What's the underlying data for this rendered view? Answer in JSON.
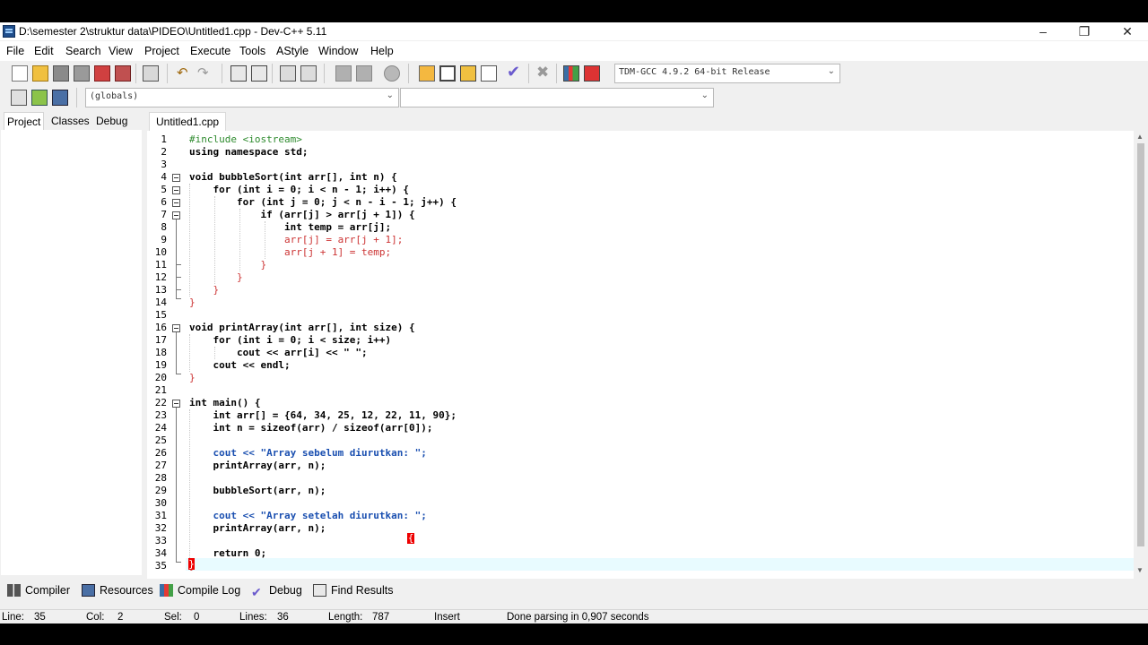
{
  "window": {
    "title": "D:\\semester 2\\struktur data\\PIDEO\\Untitled1.cpp - Dev-C++ 5.11",
    "controls": [
      "–",
      "❐",
      "✕"
    ]
  },
  "menu": [
    "File",
    "Edit",
    "Search",
    "View",
    "Project",
    "Execute",
    "Tools",
    "AStyle",
    "Window",
    "Help"
  ],
  "toolbar": {
    "compiler_select": "TDM-GCC 4.9.2 64-bit Release",
    "scope_select": "(globals)",
    "member_select": ""
  },
  "left_tabs": [
    "Project",
    "Classes",
    "Debug"
  ],
  "editor": {
    "file_tab": "Untitled1.cpp",
    "lines": [
      "#include <iostream>",
      "using namespace std;",
      "",
      "void bubbleSort(int arr[], int n) {",
      "    for (int i = 0; i < n - 1; i++) {",
      "        for (int j = 0; j < n - i - 1; j++) {",
      "            if (arr[j] > arr[j + 1]) {",
      "                int temp = arr[j];",
      "                arr[j] = arr[j + 1];",
      "                arr[j + 1] = temp;",
      "            }",
      "        }",
      "    }",
      "}",
      "",
      "void printArray(int arr[], int size) {",
      "    for (int i = 0; i < size; i++)",
      "        cout << arr[i] << \" \";",
      "    cout << endl;",
      "}",
      "",
      "int main() {",
      "    int arr[] = {64, 34, 25, 12, 22, 11, 90};",
      "    int n = sizeof(arr) / sizeof(arr[0]);",
      "",
      "    cout << \"Array sebelum diurutkan: \";",
      "    printArray(arr, n);",
      "",
      "    bubbleSort(arr, n);",
      "",
      "    cout << \"Array setelah diurutkan: \";",
      "    printArray(arr, n);",
      "",
      "    return 0;",
      "}"
    ]
  },
  "bottom_tabs": [
    "Compiler",
    "Resources",
    "Compile Log",
    "Debug",
    "Find Results"
  ],
  "status": {
    "line_label": "Line:",
    "line_value": "35",
    "col_label": "Col:",
    "col_value": "2",
    "sel_label": "Sel:",
    "sel_value": "0",
    "lines_label": "Lines:",
    "lines_value": "36",
    "length_label": "Length:",
    "length_value": "787",
    "mode": "Insert",
    "message": "Done parsing in 0,907 seconds"
  },
  "colors": {
    "preprocessor": "#2e8b2e",
    "keyword": "#000000",
    "symbol": "#cc3333",
    "string": "#1a4fb0",
    "number": "#7c3fb8",
    "active_line": "#e8fbff",
    "brace_match": "#e00000"
  },
  "icons": [
    "app-icon",
    "new-file-icon",
    "open-icon",
    "save-icon",
    "save-all-icon",
    "close-icon",
    "print-icon",
    "undo-icon",
    "redo-icon",
    "find-icon",
    "replace-icon",
    "indent-icon",
    "unindent-icon",
    "goto-icon",
    "compile-icon",
    "run-icon",
    "compile-run-icon",
    "rebuild-icon",
    "check-icon",
    "stop-icon",
    "chart-icon",
    "profile-icon"
  ]
}
